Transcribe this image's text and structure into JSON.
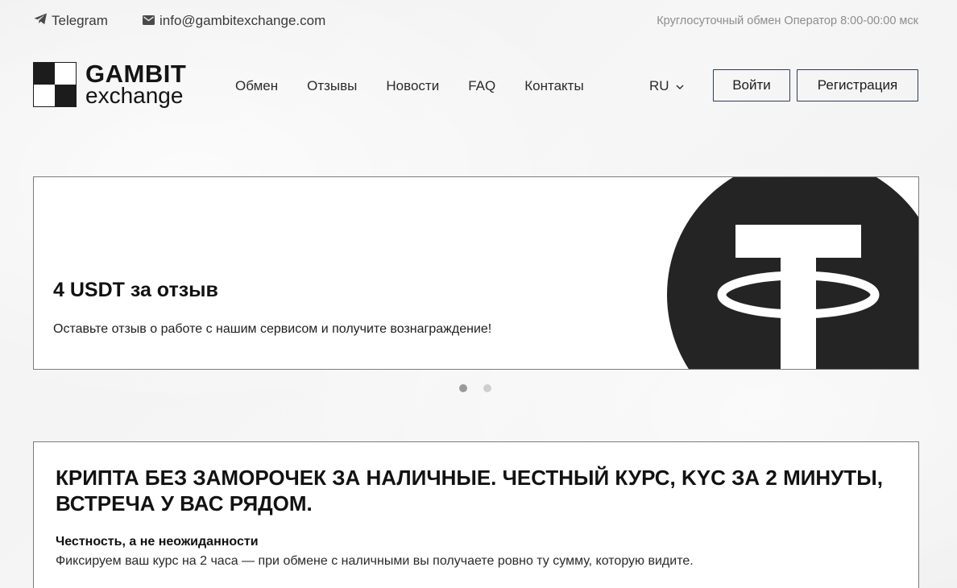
{
  "topbar": {
    "telegram_label": "Telegram",
    "email": "info@gambitexchange.com",
    "hours": "Круглосуточный обмен Оператор 8:00-00:00 мск"
  },
  "logo": {
    "line1": "GAMBIT",
    "line2": "exchange"
  },
  "nav": {
    "items": [
      "Обмен",
      "Отзывы",
      "Новости",
      "FAQ",
      "Контакты"
    ]
  },
  "lang": {
    "selected": "RU"
  },
  "auth": {
    "login_label": "Войти",
    "register_label": "Регистрация"
  },
  "banner": {
    "title": "4 USDT за отзыв",
    "text": "Оставьте отзыв о работе с нашим сервисом и получите вознаграждение!",
    "icon": "tether-icon",
    "slides_total": 2,
    "active_slide": 1
  },
  "info": {
    "heading": "КРИПТА БЕЗ ЗАМОРОЧЕК ЗА НАЛИЧНЫЕ. ЧЕСТНЫЙ КУРС, KYC ЗА 2 МИНУТЫ, ВСТРЕЧА У ВАС РЯДОМ.",
    "subheading": "Честность, а не неожиданности",
    "text": "Фиксируем ваш курс на 2 часа — при обмене с наличными вы получаете ровно ту сумму, которую видите."
  },
  "colors": {
    "accent_border": "#2d3a5b",
    "dark": "#1c1c1c",
    "muted": "#8d8d8d"
  }
}
